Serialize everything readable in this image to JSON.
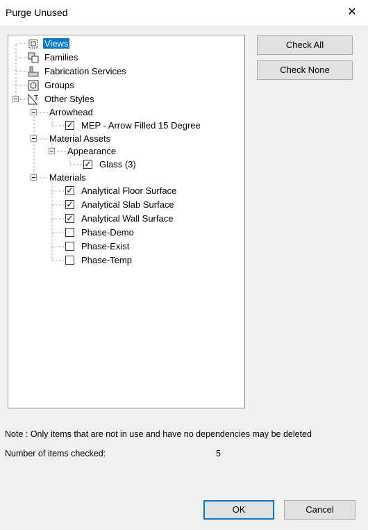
{
  "window": {
    "title": "Purge Unused",
    "close_glyph": "✕"
  },
  "tree": {
    "nodes": [
      {
        "label": "Views",
        "icon": "views-icon",
        "selected": true
      },
      {
        "label": "Families",
        "icon": "families-icon"
      },
      {
        "label": "Fabrication Services",
        "icon": "fabrication-icon"
      },
      {
        "label": "Groups",
        "icon": "groups-icon"
      },
      {
        "label": "Other Styles",
        "icon": "styles-icon",
        "expanded": true
      },
      {
        "label": "Arrowhead",
        "expanded": true
      },
      {
        "label": "MEP - Arrow Filled 15 Degree",
        "checked": true
      },
      {
        "label": "Material Assets",
        "expanded": true
      },
      {
        "label": "Appearance",
        "expanded": true
      },
      {
        "label": "Glass (3)",
        "checked": true
      },
      {
        "label": "Materials",
        "expanded": true
      },
      {
        "label": "Analytical Floor Surface",
        "checked": true
      },
      {
        "label": "Analytical Slab Surface",
        "checked": true
      },
      {
        "label": "Analytical Wall Surface",
        "checked": true
      },
      {
        "label": "Phase-Demo",
        "checked": false
      },
      {
        "label": "Phase-Exist",
        "checked": false
      },
      {
        "label": "Phase-Temp",
        "checked": false
      }
    ]
  },
  "buttons": {
    "check_all": "Check All",
    "check_none": "Check None",
    "ok": "OK",
    "cancel": "Cancel"
  },
  "note": "Note : Only items that are not in use and have no dependencies may be deleted",
  "count": {
    "label": "Number of items checked:",
    "value": "5"
  },
  "colors": {
    "selection": "#0078d7",
    "default_button_border": "#0078d7"
  }
}
